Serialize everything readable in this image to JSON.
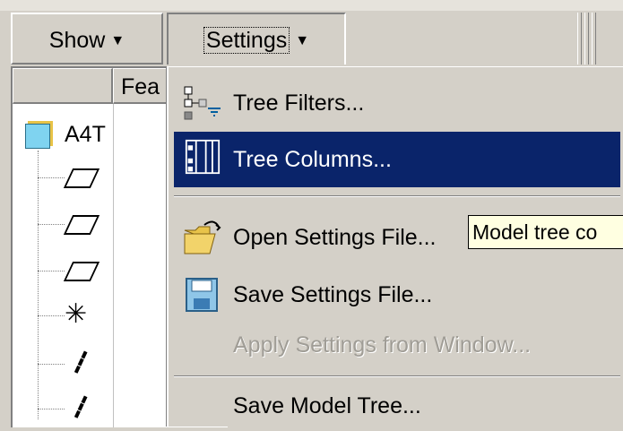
{
  "toolbar": {
    "show_label": "Show",
    "settings_label": "Settings"
  },
  "tree": {
    "column_header": "Fea",
    "root_label": "A4T"
  },
  "menu": {
    "items": [
      {
        "label": "Tree Filters...",
        "icon": "tree-filter-icon",
        "state": "normal"
      },
      {
        "label": "Tree Columns...",
        "icon": "tree-columns-icon",
        "state": "highlighted"
      },
      {
        "label": "Open Settings File...",
        "icon": "open-folder-icon",
        "state": "normal"
      },
      {
        "label": "Save Settings File...",
        "icon": "floppy-disk-icon",
        "state": "normal"
      },
      {
        "label": "Apply Settings from Window...",
        "icon": "",
        "state": "disabled"
      },
      {
        "label": "Save Model Tree...",
        "icon": "",
        "state": "normal"
      }
    ]
  },
  "tooltip": {
    "text": "Model tree co"
  },
  "colors": {
    "highlight": "#0a246a",
    "face": "#d4d0c8",
    "tooltip_bg": "#ffffe1"
  }
}
